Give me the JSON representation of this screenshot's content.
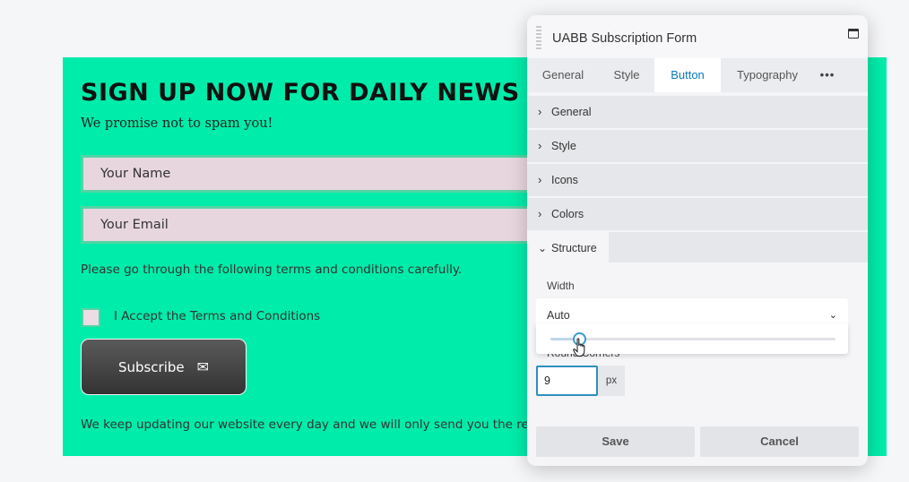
{
  "form": {
    "title": "SIGN UP NOW FOR DAILY NEWS",
    "subtitle": "We promise not to spam you!",
    "name_placeholder": "Your Name",
    "email_placeholder": "Your Email",
    "terms_text": "Please go through the following terms and conditions carefully.",
    "checkbox_label": "I Accept the Terms and Conditions",
    "subscribe_label": "Subscribe",
    "subscribe_icon": "envelope-icon",
    "footer_text": "We keep updating our website every day and we will only send you the re",
    "accent_color": "#00ecaa"
  },
  "panel": {
    "title": "UABB Subscription Form",
    "tabs": [
      {
        "label": "General",
        "active": false
      },
      {
        "label": "Style",
        "active": false
      },
      {
        "label": "Button",
        "active": true
      },
      {
        "label": "Typography",
        "active": false
      },
      {
        "label": "•••",
        "active": false
      }
    ],
    "sections": [
      "General",
      "Style",
      "Icons",
      "Colors",
      "Structure"
    ],
    "width_label": "Width",
    "width_value": "Auto",
    "round_corners_label": "Round Corners",
    "round_corners_value": "9",
    "round_corners_unit": "px",
    "slider_fraction": 0.1,
    "save_label": "Save",
    "cancel_label": "Cancel",
    "active_tab_color": "#0b79b8"
  }
}
